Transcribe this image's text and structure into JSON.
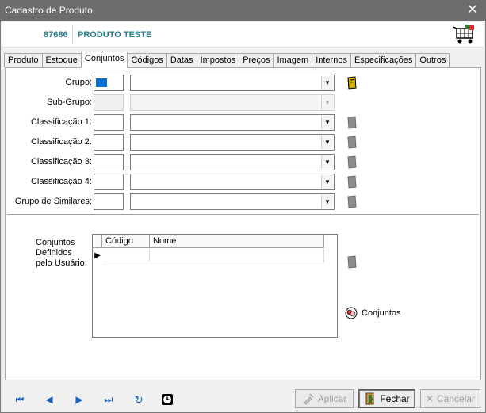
{
  "window": {
    "title": "Cadastro de Produto"
  },
  "header": {
    "code": "87686",
    "name": "PRODUTO TESTE"
  },
  "tabs": [
    "Produto",
    "Estoque",
    "Conjuntos",
    "Códigos",
    "Datas",
    "Impostos",
    "Preços",
    "Imagem",
    "Internos",
    "Especificações",
    "Outros"
  ],
  "active_tab": "Conjuntos",
  "form": {
    "rows": [
      {
        "label": "Grupo:",
        "code": "",
        "value": ""
      },
      {
        "label": "Sub-Grupo:",
        "code": "",
        "value": ""
      },
      {
        "label": "Classificação 1:",
        "code": "",
        "value": ""
      },
      {
        "label": "Classificação 2:",
        "code": "",
        "value": ""
      },
      {
        "label": "Classificação 3:",
        "code": "",
        "value": ""
      },
      {
        "label": "Classificação 4:",
        "code": "",
        "value": ""
      },
      {
        "label": "Grupo de Similares:",
        "code": "",
        "value": ""
      }
    ]
  },
  "user_sets": {
    "label_lines": [
      "Conjuntos",
      "Definidos",
      "pelo Usuário:"
    ],
    "columns": [
      "Código",
      "Nome"
    ],
    "button_label": "Conjuntos"
  },
  "footer": {
    "apply": "Aplicar",
    "close": "Fechar",
    "cancel": "Cancelar"
  },
  "colors": {
    "title_bar": "#6d6d6d",
    "accent_teal": "#2a7d8c",
    "nav_blue": "#1565c0"
  }
}
